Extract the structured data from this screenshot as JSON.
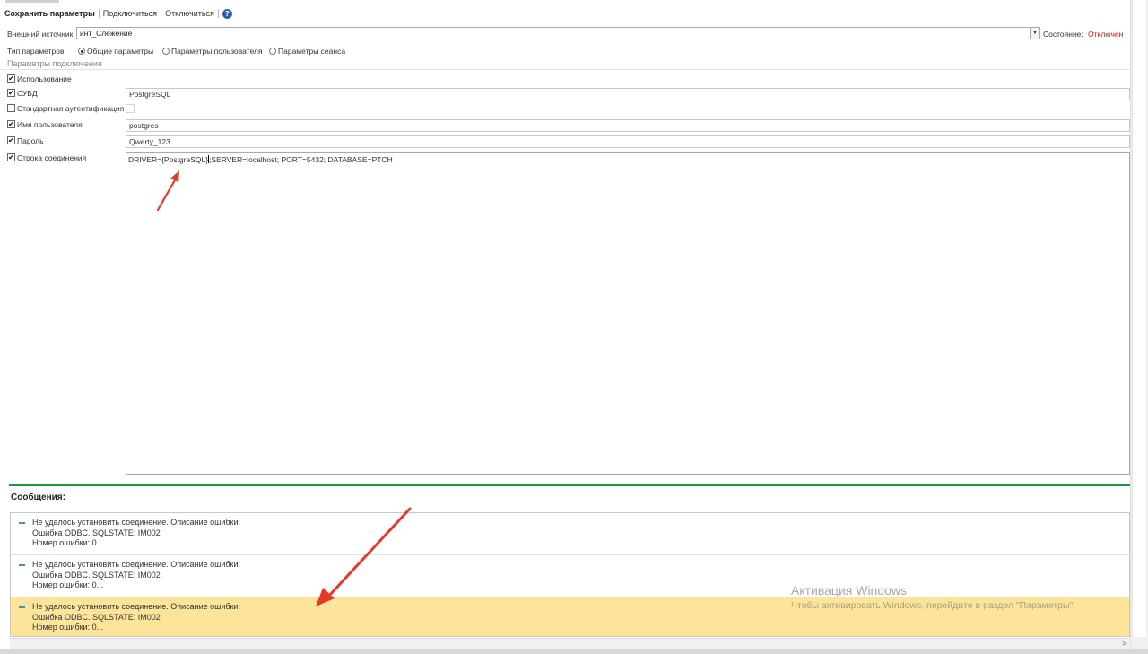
{
  "toolbar": {
    "save": "Сохранить параметры",
    "connect": "Подключиться",
    "disconnect": "Отключиться",
    "help_icon": "question-circle-icon"
  },
  "source": {
    "label": "Внешний источник:",
    "value": "инт_Слежение",
    "state_label": "Состояние:",
    "state_value": "Отключен",
    "state_color": "#d01818"
  },
  "param_type": {
    "label": "Тип параметров:",
    "options": [
      "Общие параметры",
      "Параметры пользователя",
      "Параметры сеанса"
    ],
    "selected": "Общие параметры"
  },
  "section": {
    "title": "Параметры подключения"
  },
  "params": {
    "usage": {
      "label": "Использование",
      "checked": true
    },
    "dbms": {
      "label": "СУБД",
      "checked": true,
      "value": "PostgreSQL"
    },
    "std_auth": {
      "label": "Стандартная аутентификация",
      "checked": false
    },
    "user": {
      "label": "Имя пользователя",
      "checked": true,
      "value": "postgres"
    },
    "password": {
      "label": "Пароль",
      "checked": true,
      "value": "Qwerty_123"
    },
    "conn_string": {
      "label": "Строка соединения",
      "checked": true,
      "value_before_cursor": "DRIVER={PostgreSQL}",
      "value_after_cursor": ";SERVER=localhost; PORT=5432; DATABASE=PTCH"
    }
  },
  "messages": {
    "title": "Сообщения:",
    "items": [
      {
        "line1": "Не удалось установить соединение. Описание ошибки:",
        "line2": "Ошибка ODBC. SQLSTATE: IM002",
        "line3": "Номер ошибки: 0..."
      },
      {
        "line1": "Не удалось установить соединение. Описание ошибки:",
        "line2": "Ошибка ODBC. SQLSTATE: IM002",
        "line3": "Номер ошибки: 0..."
      },
      {
        "line1": "Не удалось установить соединение. Описание ошибки:",
        "line2": "Ошибка ODBC. SQLSTATE: IM002",
        "line3": "Номер ошибки: 0...",
        "highlighted": true
      }
    ],
    "highlight_color": "#fce59a"
  },
  "watermark": {
    "line1": "Активация Windows",
    "line2": "Чтобы активировать Windows, перейдите в раздел \"Параметры\"."
  },
  "annotation_color": "#e53a2a"
}
